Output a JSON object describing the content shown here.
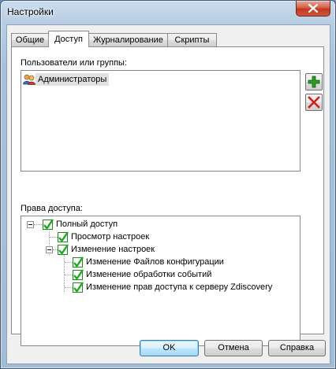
{
  "window": {
    "title": "Настройки"
  },
  "tabs": [
    {
      "label": "Общие"
    },
    {
      "label": "Доступ"
    },
    {
      "label": "Журналирование"
    },
    {
      "label": "Скрипты"
    }
  ],
  "users": {
    "label": "Пользователи или группы:",
    "items": [
      {
        "label": "Администраторы",
        "icon": "users-group-icon"
      }
    ],
    "add_icon": "plus-green-icon",
    "remove_icon": "cross-red-icon"
  },
  "rights": {
    "label": "Права доступа:",
    "tree": [
      {
        "label": "Полный доступ",
        "checked": true,
        "expanded": true
      },
      {
        "label": "Просмотр настроек",
        "checked": true
      },
      {
        "label": "Изменение настроек",
        "checked": true,
        "expanded": true
      },
      {
        "label": "Изменение Файлов конфигурации",
        "checked": true
      },
      {
        "label": "Изменение обработки событий",
        "checked": true
      },
      {
        "label": "Изменение прав доступа к серверу Zdiscovery",
        "checked": true
      }
    ]
  },
  "buttons": {
    "ok": "OK",
    "cancel": "Отмена",
    "help": "Справка"
  },
  "colors": {
    "check": "#1fa81f",
    "add": "#2a9a2a",
    "remove": "#d02020",
    "selection": "#e1e1e1"
  }
}
